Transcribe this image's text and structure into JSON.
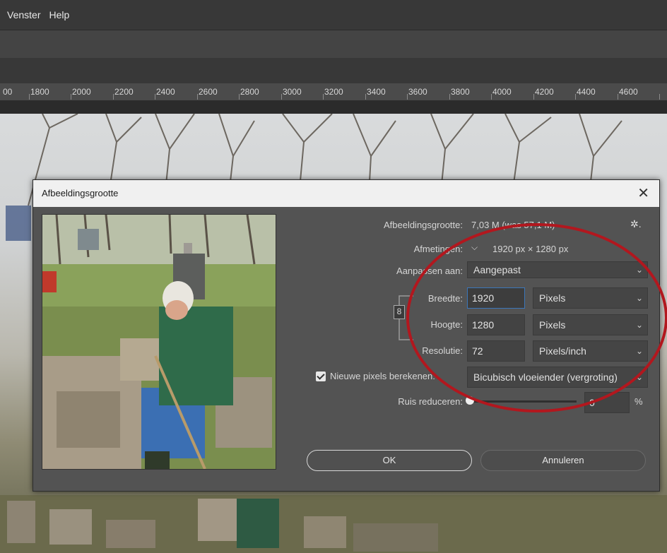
{
  "menu": {
    "items": [
      "Venster",
      "Help"
    ]
  },
  "ruler": {
    "ticks": [
      "00",
      "1800",
      "2000",
      "2200",
      "2400",
      "2600",
      "2800",
      "3000",
      "3200",
      "3400",
      "3600",
      "3800",
      "4000",
      "4200",
      "4400",
      "4600"
    ]
  },
  "dialog": {
    "title": "Afbeeldingsgrootte",
    "close_glyph": "✕",
    "image_size_label": "Afbeeldingsgrootte:",
    "image_size_value": "7,03 M (was 57,1 M)",
    "dimensions_label": "Afmetingen:",
    "dimensions_value": "1920 px  ×  1280 px",
    "fit_label": "Aanpassen aan:",
    "fit_value": "Aangepast",
    "width_label": "Breedte:",
    "width_value": "1920",
    "width_unit": "Pixels",
    "height_label": "Hoogte:",
    "height_value": "1280",
    "height_unit": "Pixels",
    "resolution_label": "Resolutie:",
    "resolution_value": "72",
    "resolution_unit": "Pixels/inch",
    "resample_label": "Nieuwe pixels berekenen:",
    "resample_checked": true,
    "resample_value": "Bicubisch vloeiender (vergroting)",
    "noise_label": "Ruis reduceren:",
    "noise_value": "0",
    "noise_unit": "%",
    "ok_label": "OK",
    "cancel_label": "Annuleren"
  },
  "colors": {
    "annotation": "#b2171e",
    "focus": "#3b76b9"
  }
}
